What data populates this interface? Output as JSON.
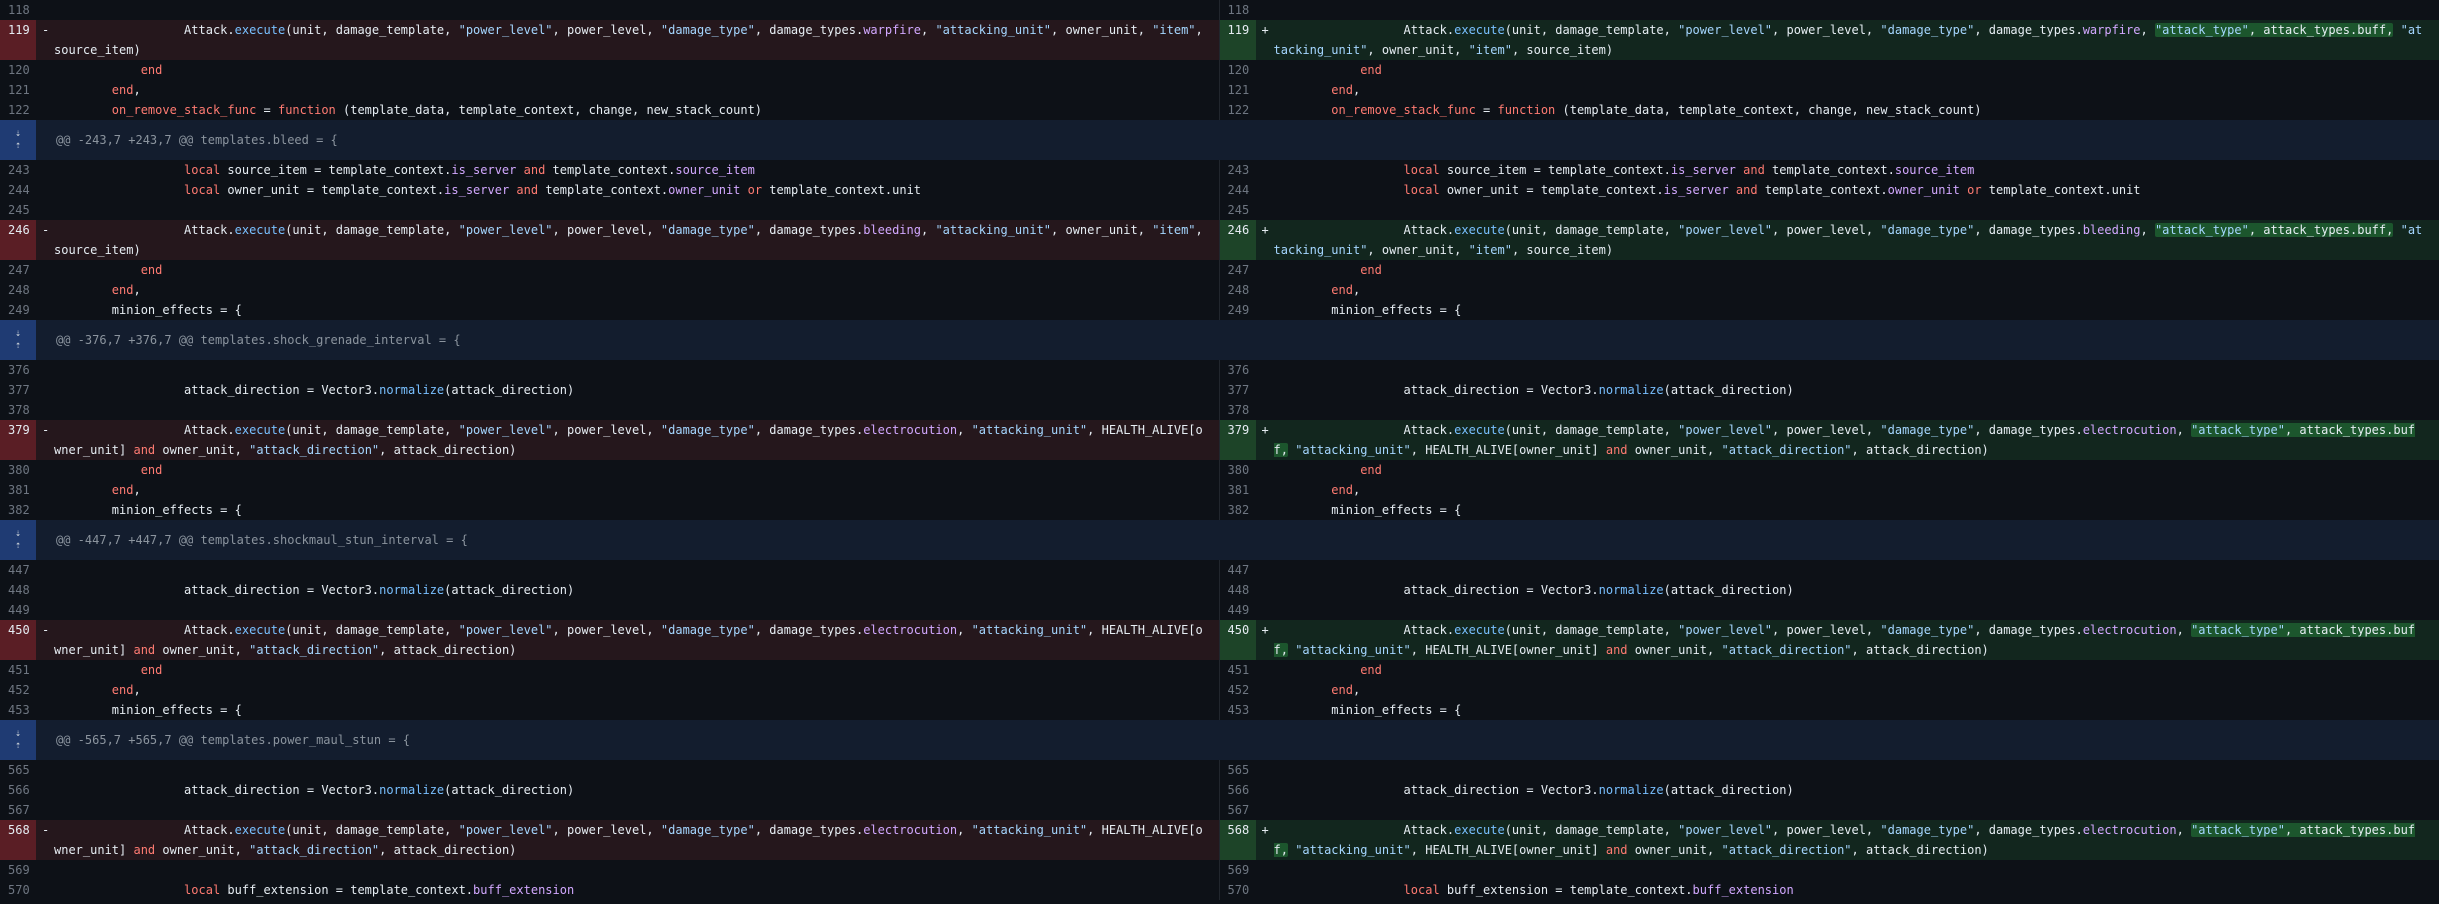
{
  "rows": [
    {
      "l": {
        "n": "118",
        "code": ""
      },
      "r": {
        "n": "118",
        "code": ""
      }
    },
    {
      "l": {
        "n": "119",
        "sign": "-",
        "code": "                  Attack.execute(unit, damage_template, \"power_level\", power_level, \"damage_type\", damage_types.warpfire, \"attacking_unit\", owner_unit, \"item\", source_item)",
        "type": "del"
      },
      "r": {
        "n": "119",
        "sign": "+",
        "code": "                  Attack.execute(unit, damage_template, \"power_level\", power_level, \"damage_type\", damage_types.warpfire, \"attack_type\", attack_types.buff, \"attacking_unit\", owner_unit, \"item\", source_item)",
        "type": "add"
      }
    },
    {
      "l": {
        "n": "120",
        "code": "            end"
      },
      "r": {
        "n": "120",
        "code": "            end"
      }
    },
    {
      "l": {
        "n": "121",
        "code": "        end,"
      },
      "r": {
        "n": "121",
        "code": "        end,"
      }
    },
    {
      "l": {
        "n": "122",
        "code": "        on_remove_stack_func = function (template_data, template_context, change, new_stack_count)"
      },
      "r": {
        "n": "122",
        "code": "        on_remove_stack_func = function (template_data, template_context, change, new_stack_count)"
      }
    },
    {
      "hunk": "@@ -243,7 +243,7 @@ templates.bleed = {"
    },
    {
      "l": {
        "n": "243",
        "code": "                  local source_item = template_context.is_server and template_context.source_item"
      },
      "r": {
        "n": "243",
        "code": "                  local source_item = template_context.is_server and template_context.source_item"
      }
    },
    {
      "l": {
        "n": "244",
        "code": "                  local owner_unit = template_context.is_server and template_context.owner_unit or template_context.unit"
      },
      "r": {
        "n": "244",
        "code": "                  local owner_unit = template_context.is_server and template_context.owner_unit or template_context.unit"
      }
    },
    {
      "l": {
        "n": "245",
        "code": ""
      },
      "r": {
        "n": "245",
        "code": ""
      }
    },
    {
      "l": {
        "n": "246",
        "sign": "-",
        "code": "                  Attack.execute(unit, damage_template, \"power_level\", power_level, \"damage_type\", damage_types.bleeding, \"attacking_unit\", owner_unit, \"item\", source_item)",
        "type": "del"
      },
      "r": {
        "n": "246",
        "sign": "+",
        "code": "                  Attack.execute(unit, damage_template, \"power_level\", power_level, \"damage_type\", damage_types.bleeding, \"attack_type\", attack_types.buff, \"attacking_unit\", owner_unit, \"item\", source_item)",
        "type": "add"
      }
    },
    {
      "l": {
        "n": "247",
        "code": "            end"
      },
      "r": {
        "n": "247",
        "code": "            end"
      }
    },
    {
      "l": {
        "n": "248",
        "code": "        end,"
      },
      "r": {
        "n": "248",
        "code": "        end,"
      }
    },
    {
      "l": {
        "n": "249",
        "code": "        minion_effects = {"
      },
      "r": {
        "n": "249",
        "code": "        minion_effects = {"
      }
    },
    {
      "hunk": "@@ -376,7 +376,7 @@ templates.shock_grenade_interval = {"
    },
    {
      "l": {
        "n": "376",
        "code": ""
      },
      "r": {
        "n": "376",
        "code": ""
      }
    },
    {
      "l": {
        "n": "377",
        "code": "                  attack_direction = Vector3.normalize(attack_direction)"
      },
      "r": {
        "n": "377",
        "code": "                  attack_direction = Vector3.normalize(attack_direction)"
      }
    },
    {
      "l": {
        "n": "378",
        "code": ""
      },
      "r": {
        "n": "378",
        "code": ""
      }
    },
    {
      "l": {
        "n": "379",
        "sign": "-",
        "code": "                  Attack.execute(unit, damage_template, \"power_level\", power_level, \"damage_type\", damage_types.electrocution, \"attacking_unit\", HEALTH_ALIVE[owner_unit] and owner_unit, \"attack_direction\", attack_direction)",
        "type": "del"
      },
      "r": {
        "n": "379",
        "sign": "+",
        "code": "                  Attack.execute(unit, damage_template, \"power_level\", power_level, \"damage_type\", damage_types.electrocution, \"attack_type\", attack_types.buff, \"attacking_unit\", HEALTH_ALIVE[owner_unit] and owner_unit, \"attack_direction\", attack_direction)",
        "type": "add"
      }
    },
    {
      "l": {
        "n": "380",
        "code": "            end"
      },
      "r": {
        "n": "380",
        "code": "            end"
      }
    },
    {
      "l": {
        "n": "381",
        "code": "        end,"
      },
      "r": {
        "n": "381",
        "code": "        end,"
      }
    },
    {
      "l": {
        "n": "382",
        "code": "        minion_effects = {"
      },
      "r": {
        "n": "382",
        "code": "        minion_effects = {"
      }
    },
    {
      "hunk": "@@ -447,7 +447,7 @@ templates.shockmaul_stun_interval = {"
    },
    {
      "l": {
        "n": "447",
        "code": ""
      },
      "r": {
        "n": "447",
        "code": ""
      }
    },
    {
      "l": {
        "n": "448",
        "code": "                  attack_direction = Vector3.normalize(attack_direction)"
      },
      "r": {
        "n": "448",
        "code": "                  attack_direction = Vector3.normalize(attack_direction)"
      }
    },
    {
      "l": {
        "n": "449",
        "code": ""
      },
      "r": {
        "n": "449",
        "code": ""
      }
    },
    {
      "l": {
        "n": "450",
        "sign": "-",
        "code": "                  Attack.execute(unit, damage_template, \"power_level\", power_level, \"damage_type\", damage_types.electrocution, \"attacking_unit\", HEALTH_ALIVE[owner_unit] and owner_unit, \"attack_direction\", attack_direction)",
        "type": "del"
      },
      "r": {
        "n": "450",
        "sign": "+",
        "code": "                  Attack.execute(unit, damage_template, \"power_level\", power_level, \"damage_type\", damage_types.electrocution, \"attack_type\", attack_types.buff, \"attacking_unit\", HEALTH_ALIVE[owner_unit] and owner_unit, \"attack_direction\", attack_direction)",
        "type": "add"
      }
    },
    {
      "l": {
        "n": "451",
        "code": "            end"
      },
      "r": {
        "n": "451",
        "code": "            end"
      }
    },
    {
      "l": {
        "n": "452",
        "code": "        end,"
      },
      "r": {
        "n": "452",
        "code": "        end,"
      }
    },
    {
      "l": {
        "n": "453",
        "code": "        minion_effects = {"
      },
      "r": {
        "n": "453",
        "code": "        minion_effects = {"
      }
    },
    {
      "hunk": "@@ -565,7 +565,7 @@ templates.power_maul_stun = {"
    },
    {
      "l": {
        "n": "565",
        "code": ""
      },
      "r": {
        "n": "565",
        "code": ""
      }
    },
    {
      "l": {
        "n": "566",
        "code": "                  attack_direction = Vector3.normalize(attack_direction)"
      },
      "r": {
        "n": "566",
        "code": "                  attack_direction = Vector3.normalize(attack_direction)"
      }
    },
    {
      "l": {
        "n": "567",
        "code": ""
      },
      "r": {
        "n": "567",
        "code": ""
      }
    },
    {
      "l": {
        "n": "568",
        "sign": "-",
        "code": "                  Attack.execute(unit, damage_template, \"power_level\", power_level, \"damage_type\", damage_types.electrocution, \"attacking_unit\", HEALTH_ALIVE[owner_unit] and owner_unit, \"attack_direction\", attack_direction)",
        "type": "del"
      },
      "r": {
        "n": "568",
        "sign": "+",
        "code": "                  Attack.execute(unit, damage_template, \"power_level\", power_level, \"damage_type\", damage_types.electrocution, \"attack_type\", attack_types.buff, \"attacking_unit\", HEALTH_ALIVE[owner_unit] and owner_unit, \"attack_direction\", attack_direction)",
        "type": "add"
      }
    },
    {
      "l": {
        "n": "569",
        "code": ""
      },
      "r": {
        "n": "569",
        "code": ""
      }
    },
    {
      "l": {
        "n": "570",
        "code": "                  local buff_extension = template_context.buff_extension"
      },
      "r": {
        "n": "570",
        "code": "                  local buff_extension = template_context.buff_extension"
      }
    }
  ],
  "expand_icons": [
    "expand-down-icon",
    "expand-up-icon"
  ],
  "colors": {
    "deleted_bg": "#25171c",
    "added_bg": "#12261e",
    "hunk_bg": "#131d2e",
    "highlight": "#2ea043"
  }
}
